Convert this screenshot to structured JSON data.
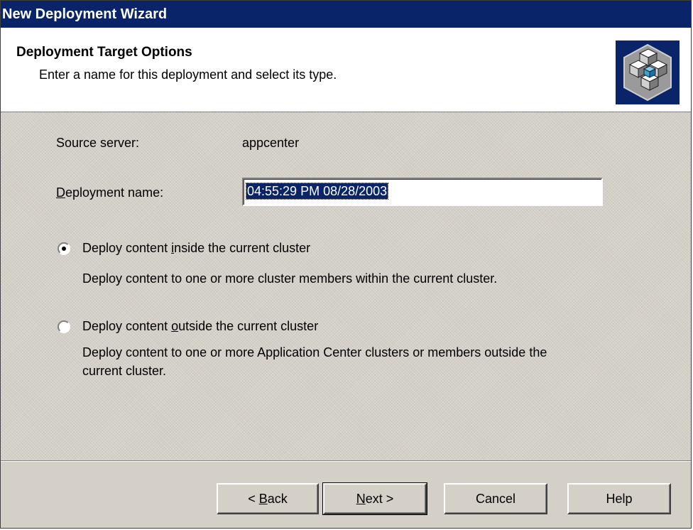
{
  "window": {
    "title": "New Deployment Wizard"
  },
  "header": {
    "title": "Deployment Target Options",
    "subtitle": "Enter a name for this deployment and select its type."
  },
  "form": {
    "source_server_label": "Source server:",
    "source_server_value": "appcenter",
    "deployment_name_label_pre": "",
    "deployment_name_label_mnemonic": "D",
    "deployment_name_label_post": "eployment name:",
    "deployment_name_value": "04:55:29 PM 08/28/2003"
  },
  "options": [
    {
      "label_pre": "Deploy content ",
      "label_mnemonic": "i",
      "label_post": "nside the current cluster",
      "description": "Deploy content to one or more cluster members within the current cluster.",
      "selected": true
    },
    {
      "label_pre": "Deploy content ",
      "label_mnemonic": "o",
      "label_post": "utside the current cluster",
      "description_line1": "Deploy content to one or more Application Center clusters or members outside the",
      "description_line2": "current cluster.",
      "selected": false
    }
  ],
  "buttons": {
    "back_pre": "< ",
    "back_mnemonic": "B",
    "back_post": "ack",
    "next_mnemonic": "N",
    "next_post": "ext >",
    "cancel": "Cancel",
    "help": "Help"
  },
  "icons": {
    "wizard": "cluster-cubes-icon"
  },
  "colors": {
    "titlebar": "#0a246a",
    "face": "#d4d0c8",
    "selection": "#0a246a"
  }
}
